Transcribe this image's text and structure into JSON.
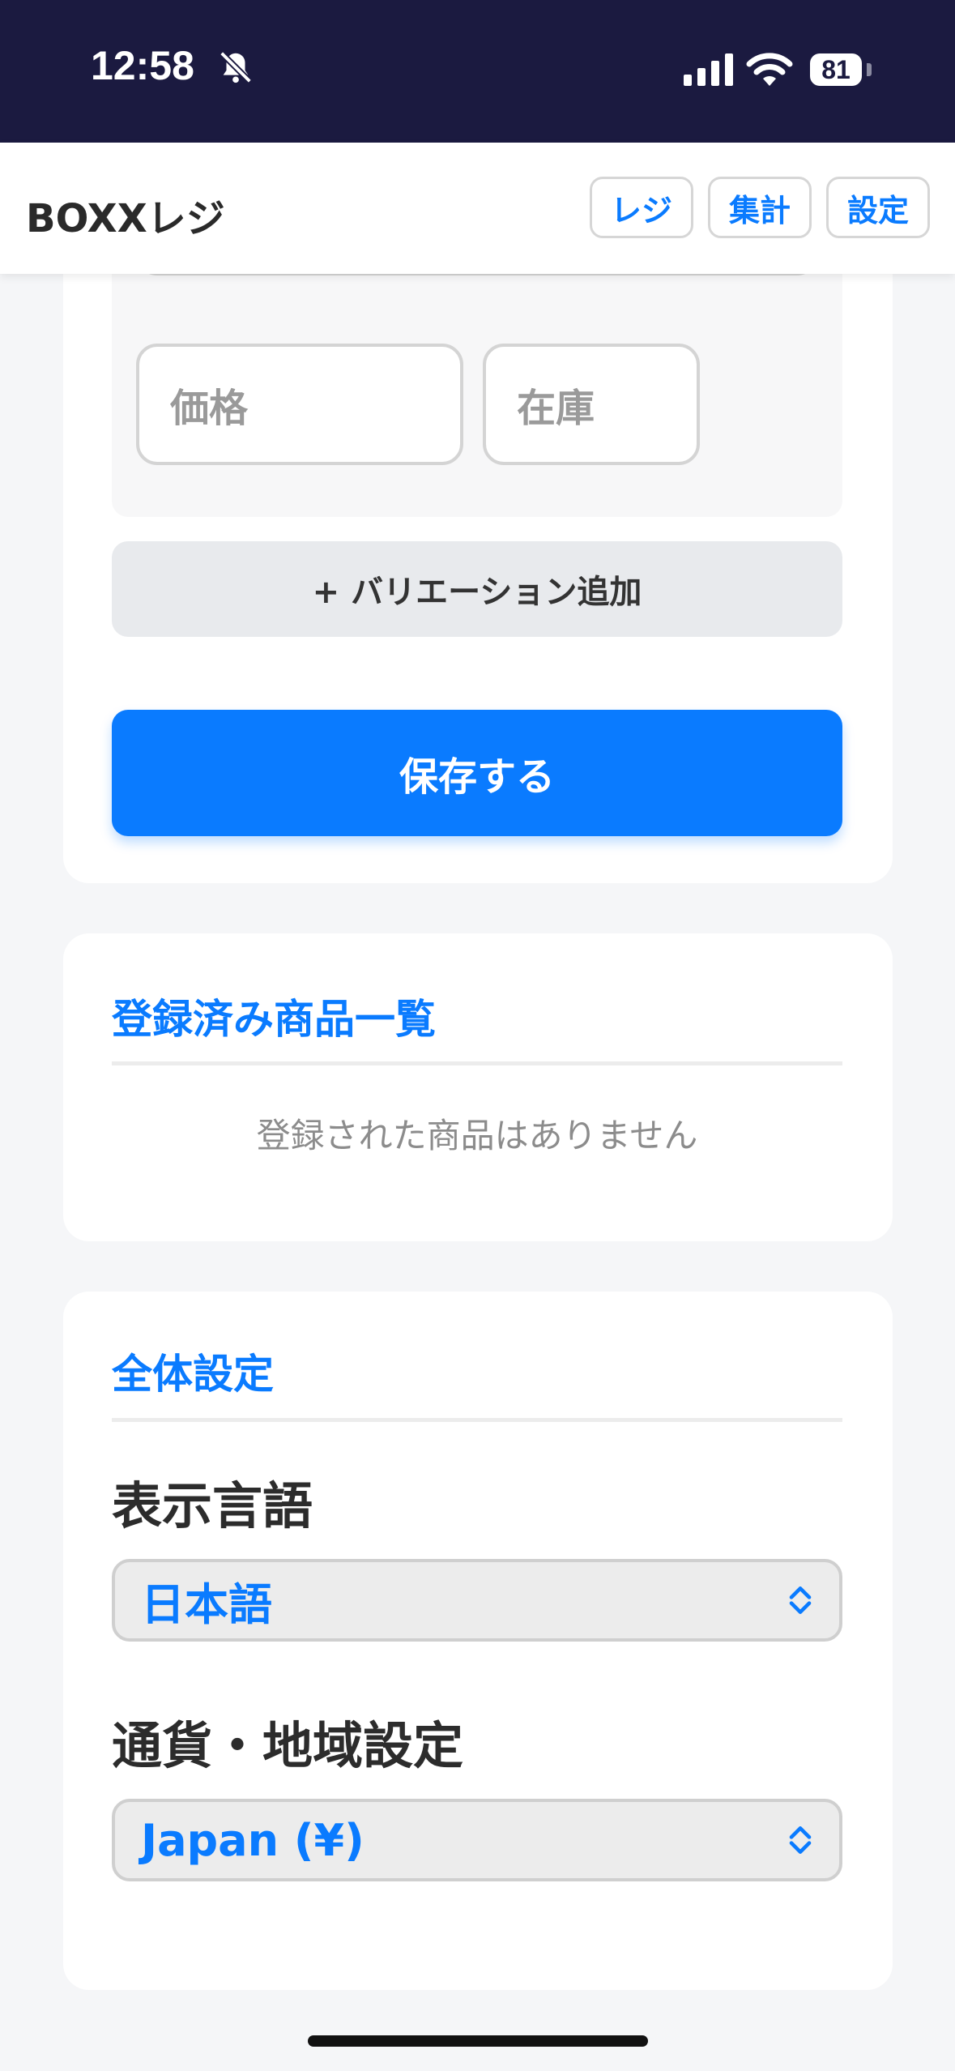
{
  "status": {
    "time": "12:58",
    "battery": "81"
  },
  "app": {
    "title": "BOXXレジ",
    "nav": [
      "レジ",
      "集計",
      "設定"
    ]
  },
  "product_form": {
    "price_placeholder": "価格",
    "stock_placeholder": "在庫",
    "add_variation_label": "+ バリエーション追加",
    "save_label": "保存する"
  },
  "product_list": {
    "title": "登録済み商品一覧",
    "empty_message": "登録された商品はありません"
  },
  "settings": {
    "title": "全体設定",
    "language_label": "表示言語",
    "language_value": "日本語",
    "currency_label": "通貨・地域設定",
    "currency_value": "Japan (¥)"
  },
  "colors": {
    "accent": "#0a7bff",
    "status_bar": "#1b1a40"
  }
}
